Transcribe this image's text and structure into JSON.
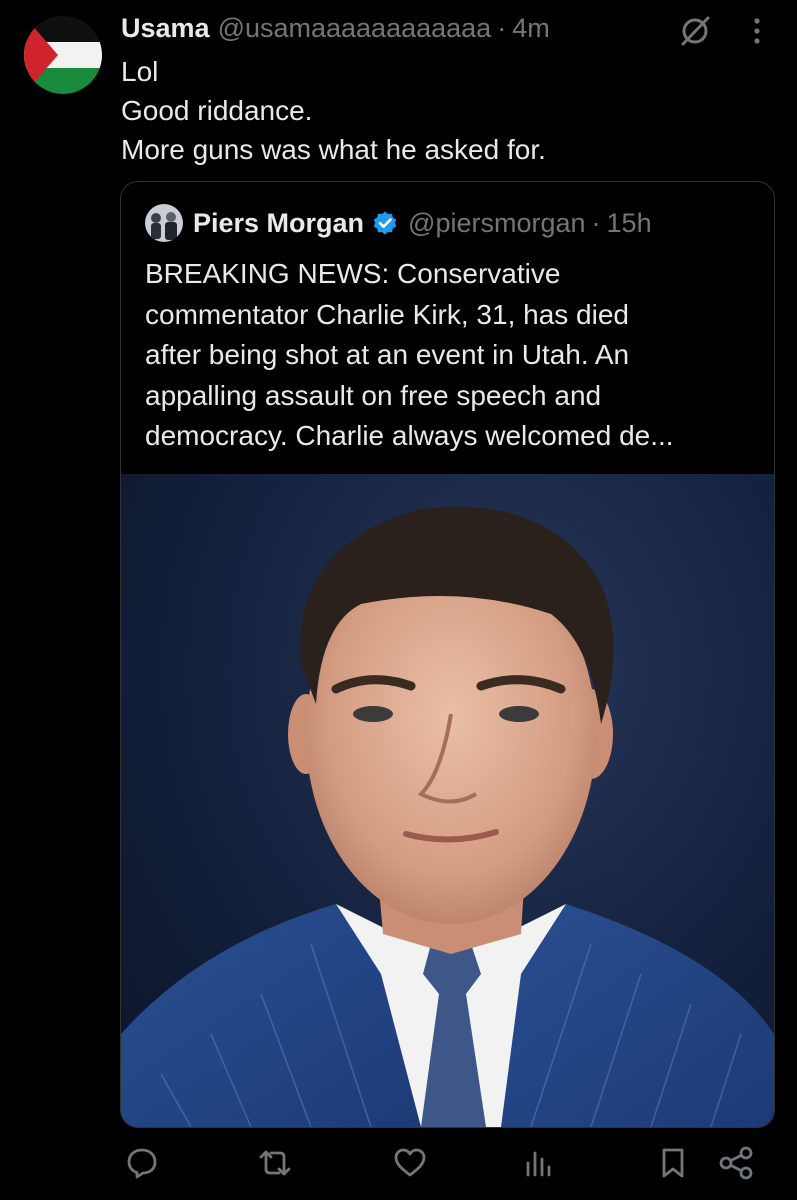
{
  "tweet": {
    "author_name": "Usama",
    "author_handle": "@usamaaaaaaaaaaaa",
    "separator": "·",
    "time": "4m",
    "text_lines": [
      "Lol",
      "Good riddance.",
      "More guns was what he asked for."
    ]
  },
  "quoted": {
    "author_name": "Piers Morgan",
    "author_handle": "@piersmorgan",
    "separator": "·",
    "time": "15h",
    "text_lines": [
      "BREAKING NEWS: Conservative",
      "commentator Charlie Kirk, 31, has died",
      "after being shot at an event in Utah. An",
      "appalling assault on free speech and",
      "democracy. Charlie always welcomed de..."
    ]
  },
  "icons": {
    "grok": "grok-icon",
    "more": "more-vertical-icon",
    "reply": "reply-icon",
    "repost": "repost-icon",
    "like": "like-icon",
    "views": "views-icon",
    "bookmark": "bookmark-icon",
    "share": "share-icon",
    "verified": "verified-badge-icon"
  },
  "colors": {
    "background": "#000000",
    "text": "#e7e9ea",
    "secondary": "#71767b",
    "verified": "#1d9bf0",
    "border": "#2f3336"
  }
}
